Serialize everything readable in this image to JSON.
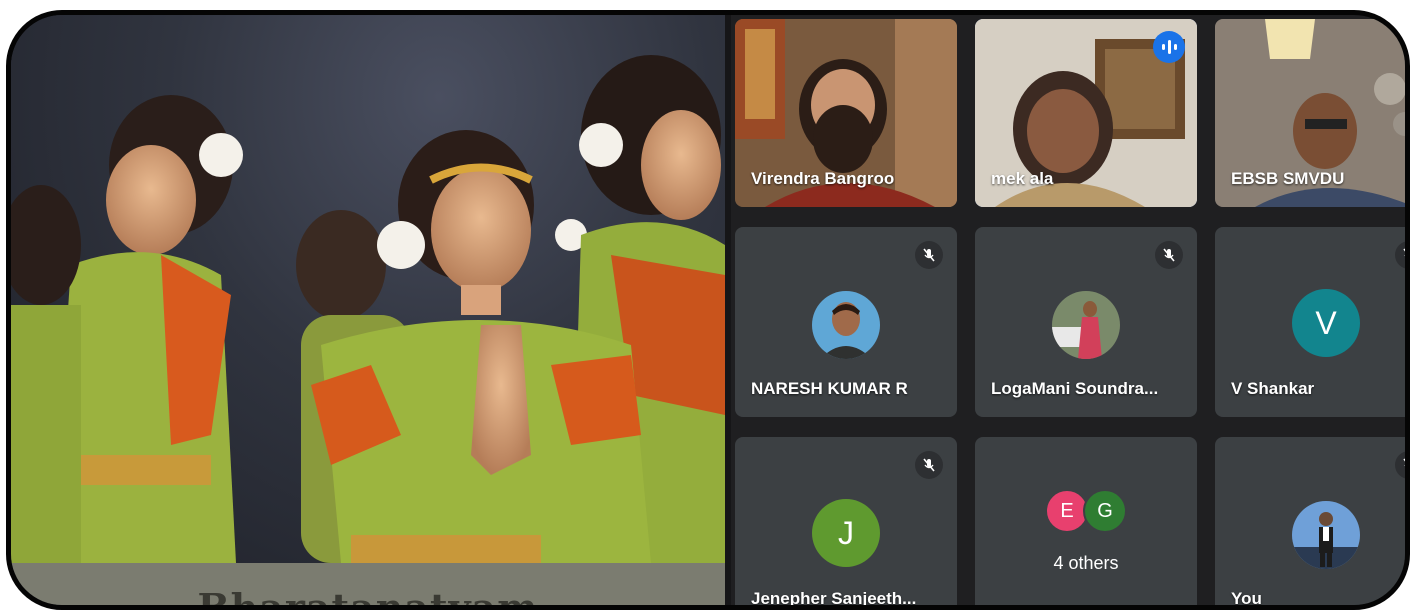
{
  "presentation": {
    "slide_caption": "Bharatanatyam"
  },
  "participants": [
    {
      "name": "Virendra Bangroo",
      "type": "video",
      "muted": false
    },
    {
      "name": "mek ala",
      "type": "video",
      "speaking": true
    },
    {
      "name": "EBSB SMVDU",
      "type": "video",
      "muted": false
    },
    {
      "name": "NARESH KUMAR R",
      "type": "photo-avatar",
      "muted": true
    },
    {
      "name": "LogaMani Soundra...",
      "type": "photo-avatar",
      "muted": true
    },
    {
      "name": "V Shankar",
      "type": "letter-avatar",
      "initial": "V",
      "color": "#12858e",
      "muted": true
    },
    {
      "name": "Jenepher Sanjeeth...",
      "type": "letter-avatar",
      "initial": "J",
      "color": "#5f9a2f",
      "muted": true
    },
    {
      "name": "You",
      "type": "photo-avatar",
      "muted": true
    }
  ],
  "others": {
    "label": "4 others",
    "initials": [
      {
        "initial": "E",
        "color": "#e8406e"
      },
      {
        "initial": "G",
        "color": "#2f7d32"
      }
    ]
  },
  "colors": {
    "tile_bg": "#3c4043",
    "active_border": "#8ab4f8",
    "speaking_blue": "#1a73e8"
  }
}
